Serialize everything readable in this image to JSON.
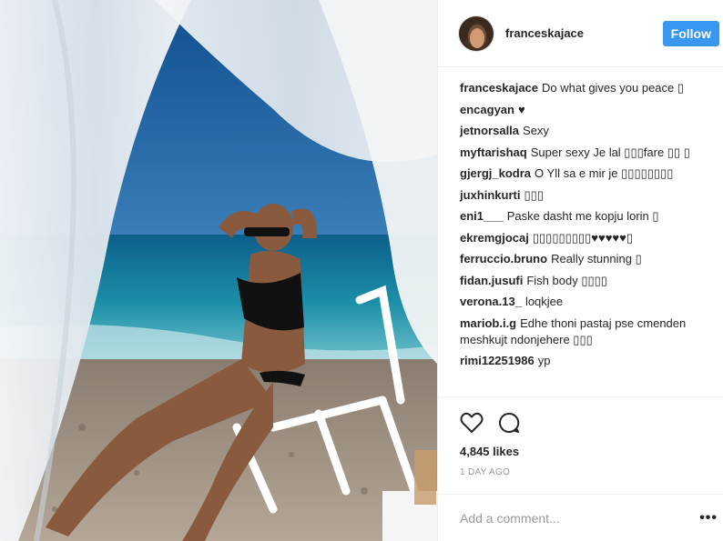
{
  "post": {
    "username": "franceskajace",
    "follow_label": "Follow",
    "photo_subject": "woman in black swimsuit on a white chair at a pebble beach",
    "likes": "4,845 likes",
    "time_ago": "1 DAY AGO",
    "add_comment_placeholder": "Add a comment...",
    "more_label": "•••"
  },
  "comments": [
    {
      "user": "franceskajace",
      "text": "Do what gives you peace ▯"
    },
    {
      "user": "encagyan",
      "text": "♥"
    },
    {
      "user": "jetnorsalla",
      "text": "Sexy"
    },
    {
      "user": "myftarishaq",
      "text": "Super sexy Je lal ▯▯▯fare ▯▯ ▯"
    },
    {
      "user": "gjergj_kodra",
      "text": "O Yll sa e mir je ▯▯▯▯▯▯▯▯"
    },
    {
      "user": "juxhinkurti",
      "text": "▯▯▯"
    },
    {
      "user": "eni1___",
      "text": "Paske dasht me kopju lorin ▯"
    },
    {
      "user": "ekremgjocaj",
      "text": "▯▯▯▯▯▯▯▯▯♥♥♥♥♥▯"
    },
    {
      "user": "ferruccio.bruno",
      "text": "Really stunning ▯"
    },
    {
      "user": "fidan.jusufi",
      "text": "Fish body ▯▯▯▯"
    },
    {
      "user": "verona.13_",
      "text": "loqkjee"
    },
    {
      "user": "mariob.i.g",
      "text": "Edhe thoni pastaj pse cmenden meshkujt ndonjehere ▯▯▯"
    },
    {
      "user": "rimi12251986",
      "text": "yp"
    }
  ],
  "icons": {
    "like": "heart-outline-icon",
    "comment": "speech-bubble-icon"
  },
  "colors": {
    "follow_bg": "#3897f0",
    "text": "#262626",
    "muted": "#999999"
  }
}
